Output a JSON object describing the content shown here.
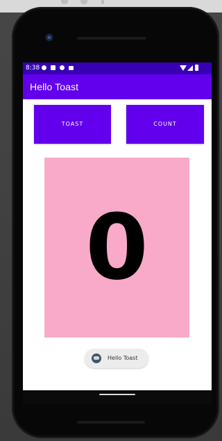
{
  "status_bar": {
    "time": "8:38"
  },
  "app_bar": {
    "title": "Hello Toast"
  },
  "buttons": {
    "toast_label": "TOAST",
    "count_label": "COUNT"
  },
  "counter": {
    "value": "0"
  },
  "toast_message": {
    "text": "Hello Toast"
  },
  "colors": {
    "primary": "#6200ee",
    "status_bar": "#3700b3",
    "count_background": "#f9aac8"
  },
  "icons": {
    "status": [
      "settings-icon",
      "notification-icon",
      "sync-icon",
      "shopping-bag-icon",
      "wifi-icon",
      "signal-icon",
      "battery-icon"
    ],
    "toast": "app-icon"
  }
}
